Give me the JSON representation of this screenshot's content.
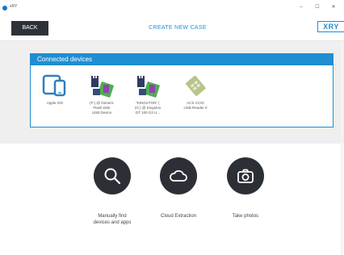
{
  "window": {
    "app_name": "xRY",
    "minimize": "–",
    "maximize": "☐",
    "close": "✕"
  },
  "toolbar": {
    "back_label": "BACK",
    "title": "CREATE NEW CASE",
    "logo": "XRY"
  },
  "devices_panel": {
    "title": "Connected devices",
    "devices": [
      {
        "label": "Apple iOS",
        "icon": "apple-ios-device-icon"
      },
      {
        "label": "(F:) @ Generic\nFlash Disk\nUSB Device",
        "icon": "flash-disk-icon"
      },
      {
        "label": "\"KINGSTON\" (\n(G:) @ Kingston\nDT 100 G2 U...",
        "icon": "flash-disk-icon"
      },
      {
        "label": "ACS CCID\nUSB Reader 0",
        "icon": "sim-card-reader-icon"
      }
    ]
  },
  "actions": [
    {
      "label": "Manually find\ndevices and apps",
      "icon": "search-icon"
    },
    {
      "label": "Cloud Extraction",
      "icon": "cloud-icon"
    },
    {
      "label": "Take photos",
      "icon": "camera-icon"
    }
  ],
  "colors": {
    "accent": "#1f8ed2",
    "dark": "#2c3036",
    "background_gray": "#efefef"
  }
}
